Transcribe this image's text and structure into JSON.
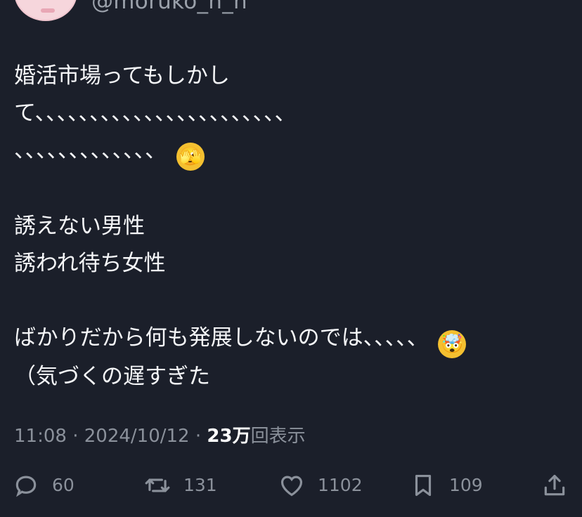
{
  "author": {
    "handle": "@moruko_n_n"
  },
  "tweet": {
    "line1": "婚活市場ってもしかし",
    "line2": "て、、、、、、、、、、、、、、、、、、、、、、、",
    "line3": "、、、、、、、、、、、、、",
    "emoji1": "🫣",
    "line5": "誘えない男性",
    "line6": "誘われ待ち女性",
    "line8": "ばかりだから何も発展しないのでは、、、、、",
    "emoji2": "🤯",
    "line9": "（気づくの遅すぎた"
  },
  "meta": {
    "time": "11:08",
    "sep1": " · ",
    "date": "2024/10/12",
    "sep2": " · ",
    "views_number": "23万",
    "views_label": "回表示"
  },
  "actions": {
    "replies": "60",
    "retweets": "131",
    "likes": "1102",
    "bookmarks": "109"
  },
  "icons": {
    "reply": "reply-icon",
    "retweet": "retweet-icon",
    "like": "like-icon",
    "bookmark": "bookmark-icon",
    "share": "share-icon"
  },
  "colors": {
    "background": "#1b1f2a",
    "text": "#f5f6f8",
    "muted": "#8b919b"
  }
}
